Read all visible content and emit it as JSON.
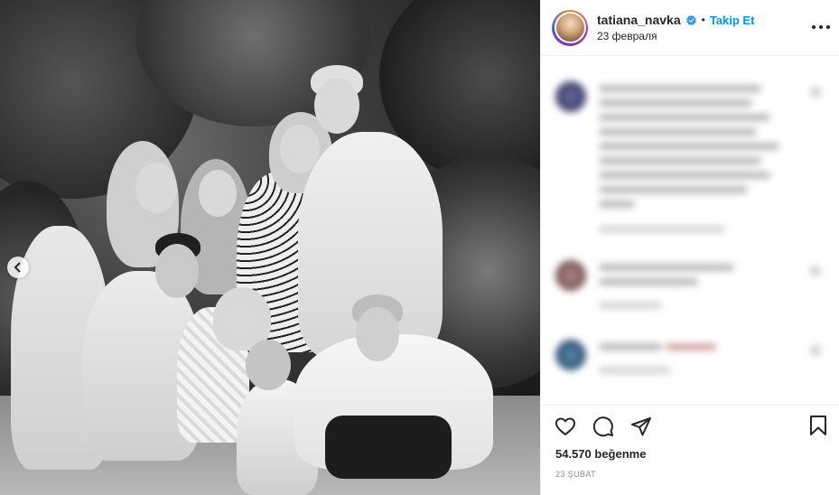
{
  "header": {
    "username": "tatiana_navka",
    "separator": "•",
    "follow_label": "Takip Et",
    "posted_date": "23 февраля",
    "avatar_icon": "profile-avatar",
    "verified_icon": "verified-badge-icon",
    "verified_color": "#3897f0",
    "more_icon": "more-options-icon"
  },
  "photo": {
    "description_icon": "post-photo",
    "prev_icon": "chevron-left-icon"
  },
  "actions": {
    "like_icon": "heart-icon",
    "comment_icon": "comment-icon",
    "share_icon": "share-icon",
    "save_icon": "bookmark-icon",
    "likes_count": "54.570 beğenme",
    "date": "23 ŞUBAT"
  },
  "colors": {
    "accent": "#0095f6",
    "text": "#262626",
    "secondary": "#8e8e8e",
    "border": "#efefef"
  }
}
